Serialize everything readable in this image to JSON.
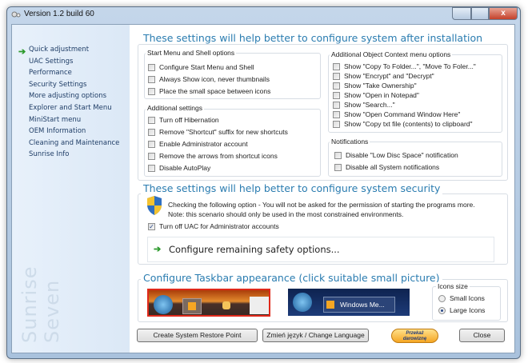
{
  "window": {
    "title": "Version 1.2 build 60",
    "close_glyph": "x"
  },
  "sidebar": {
    "brand": "Sunrise Seven",
    "items": [
      {
        "label": "Quick adjustment",
        "active": true
      },
      {
        "label": "UAC Settings"
      },
      {
        "label": "Performance"
      },
      {
        "label": "Security Settings"
      },
      {
        "label": "More adjusting options"
      },
      {
        "label": "Explorer and Start Menu"
      },
      {
        "label": "MiniStart menu"
      },
      {
        "label": "OEM Information"
      },
      {
        "label": "Cleaning and Maintenance"
      },
      {
        "label": "Sunrise Info"
      }
    ]
  },
  "install": {
    "title": "These settings will help better to configure system after installation",
    "start_menu": {
      "title": "Start Menu and Shell options",
      "items": [
        {
          "label": "Configure Start Menu and Shell",
          "checked": false
        },
        {
          "label": "Always Show icon, never thumbnails",
          "checked": false
        },
        {
          "label": "Place the small space between icons",
          "checked": false
        }
      ]
    },
    "additional": {
      "title": "Additional settings",
      "items": [
        {
          "label": "Turn off Hibernation",
          "checked": false
        },
        {
          "label": "Remove \"Shortcut\" suffix for new shortcuts",
          "checked": false
        },
        {
          "label": "Enable Administrator account",
          "checked": false
        },
        {
          "label": "Remove the arrows from shortcut icons",
          "checked": false
        },
        {
          "label": "Disable AutoPlay",
          "checked": false
        }
      ]
    },
    "context": {
      "title": "Additional Object Context menu options",
      "items": [
        {
          "label": "Show \"Copy To Folder...\", \"Move To Foler...\"",
          "checked": false
        },
        {
          "label": "Show \"Encrypt\" and \"Decrypt\"",
          "checked": false
        },
        {
          "label": "Show \"Take Ownership\"",
          "checked": false
        },
        {
          "label": "Show \"Open in Notepad\"",
          "checked": false
        },
        {
          "label": "Show \"Search...\"",
          "checked": false
        },
        {
          "label": "Show \"Open Command Window Here\"",
          "checked": false
        },
        {
          "label": "Show \"Copy txt file (contents) to clipboard\"",
          "checked": false
        }
      ]
    },
    "notifications": {
      "title": "Notifications",
      "items": [
        {
          "label": "Disable \"Low Disc Space\" notification",
          "checked": false
        },
        {
          "label": "Disable all System notifications",
          "checked": false
        }
      ]
    }
  },
  "security": {
    "title": "These settings will help better to configure system security",
    "line1": "Checking the following option - You will not be asked for the permission of starting the programs more.",
    "line2": "Note: this scenario should only be used in the most constrained environments.",
    "uac": {
      "label": "Turn off UAC for Administrator accounts",
      "checked": true
    },
    "link": "Configure remaining safety options..."
  },
  "taskbar": {
    "title": "Configure Taskbar appearance (click suitable small picture)",
    "preview2_label": "Windows Me...",
    "icons_size": {
      "title": "Icons size",
      "options": [
        {
          "label": "Small Icons",
          "selected": false
        },
        {
          "label": "Large Icons",
          "selected": true
        }
      ]
    }
  },
  "buttons": {
    "restore": "Create System Restore Point",
    "language": "Zmień język / Change Language",
    "donate": "Przekaż darowiznę",
    "close": "Close"
  }
}
